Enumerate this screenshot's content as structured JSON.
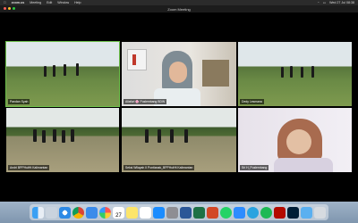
{
  "menubar": {
    "app": "zoom.us",
    "items": [
      "Meeting",
      "Edit",
      "Window",
      "Help"
    ],
    "clock": "Wed 27 Jul  08:38"
  },
  "window": {
    "title": "Zoom Meeting"
  },
  "participants": [
    {
      "name": "Pandan Syah",
      "active": true
    },
    {
      "name": "Aliafuri 🌸 Puslembang BDW"
    },
    {
      "name": "Dedy Lesmana"
    },
    {
      "name": "Andri BPPHutHt Kalimantan"
    },
    {
      "name": "Seksi Wilayah II Pontianak_BPPHutHt Kalimantan"
    },
    {
      "name": "Sri H_Puslembang"
    }
  ],
  "dock": {
    "icons": [
      "finder-icon",
      "launchpad-icon",
      "safari-icon",
      "chrome-icon",
      "mail-icon",
      "photos-icon",
      "calendar-icon",
      "notes-icon",
      "reminders-icon",
      "appstore-icon",
      "systemprefs-icon",
      "word-icon",
      "excel-icon",
      "powerpoint-icon",
      "whatsapp-icon",
      "zoom-icon",
      "telegram-icon",
      "spotify-icon",
      "acrobat-icon",
      "photoshop-icon",
      "folder-icon",
      "trash-icon"
    ],
    "calendar_day": "27"
  }
}
